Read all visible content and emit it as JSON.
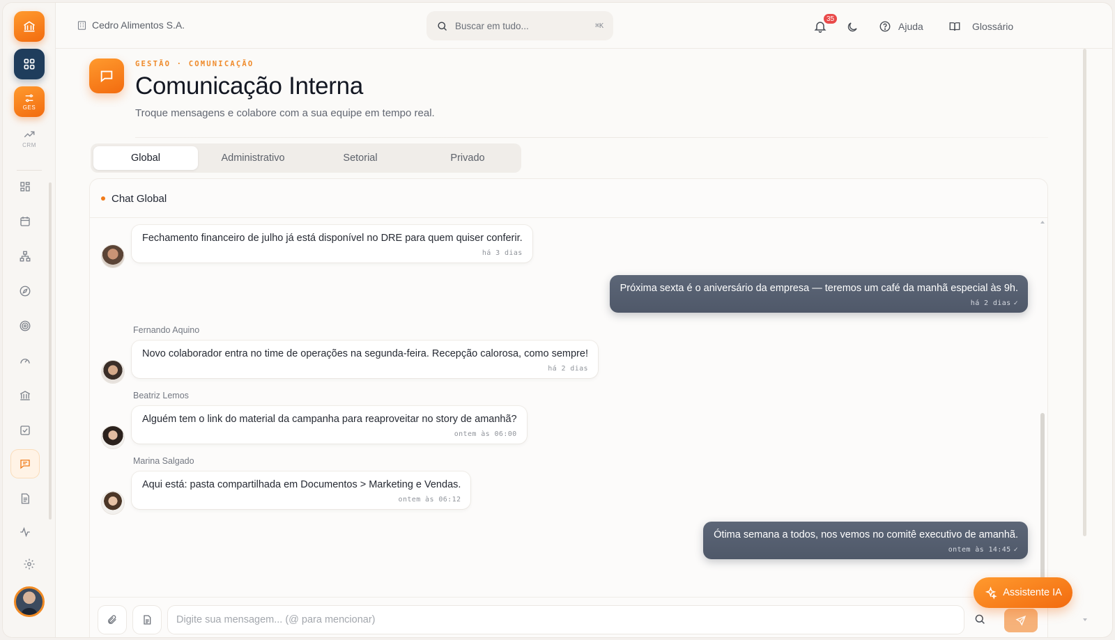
{
  "colors": {
    "accent": "#f07b1a",
    "navy": "#1f3d5c",
    "badge": "#e94a4a",
    "mine_bubble": "#535c6d"
  },
  "rail": {
    "ges_label": "GES",
    "crm_label": "CRM",
    "icons": [
      "dashboard-icon",
      "calendar-icon",
      "org-chart-icon",
      "compass-icon",
      "target-icon",
      "gauge-icon",
      "bank-icon",
      "checklist-icon",
      "chat-icon",
      "document-icon",
      "activity-icon"
    ],
    "active": "chat-icon"
  },
  "topbar": {
    "company": "Cedro Alimentos S.A.",
    "search_placeholder": "Buscar em tudo...",
    "search_shortcut": "⌘K",
    "notifications": "35",
    "help": "Ajuda",
    "glossary": "Glossário"
  },
  "header": {
    "breadcrumb": "GESTÃO · COMUNICAÇÃO",
    "title": "Comunicação Interna",
    "subtitle": "Troque mensagens e colabore com a sua equipe em tempo real."
  },
  "tabs": [
    "Global",
    "Administrativo",
    "Setorial",
    "Privado"
  ],
  "active_tab": "Global",
  "chat": {
    "title": "Chat Global",
    "messages": [
      {
        "sender": "",
        "text": "Fechamento financeiro de julho já está disponível no DRE para quem quiser conferir.",
        "time": "há 3 dias",
        "mine": false
      },
      {
        "sender": "",
        "text": "Próxima sexta é o aniversário da empresa — teremos um café da manhã especial às 9h.",
        "time": "há 2 dias",
        "mine": true
      },
      {
        "sender": "Fernando Aquino",
        "text": "Novo colaborador entra no time de operações na segunda-feira. Recepção calorosa, como sempre!",
        "time": "há 2 dias",
        "mine": false
      },
      {
        "sender": "Beatriz Lemos",
        "text": "Alguém tem o link do material da campanha para reaproveitar no story de amanhã?",
        "time": "ontem às 06:00",
        "mine": false
      },
      {
        "sender": "Marina Salgado",
        "text": "Aqui está: pasta compartilhada em Documentos > Marketing e Vendas.",
        "time": "ontem às 06:12",
        "mine": false
      },
      {
        "sender": "",
        "text": "Ótima semana a todos, nos vemos no comitê executivo de amanhã.",
        "time": "ontem às 14:45",
        "mine": true
      }
    ],
    "read_mark": "✓"
  },
  "composer": {
    "placeholder": "Digite sua mensagem... (@ para mencionar)"
  },
  "assistant": {
    "label": "Assistente IA"
  }
}
